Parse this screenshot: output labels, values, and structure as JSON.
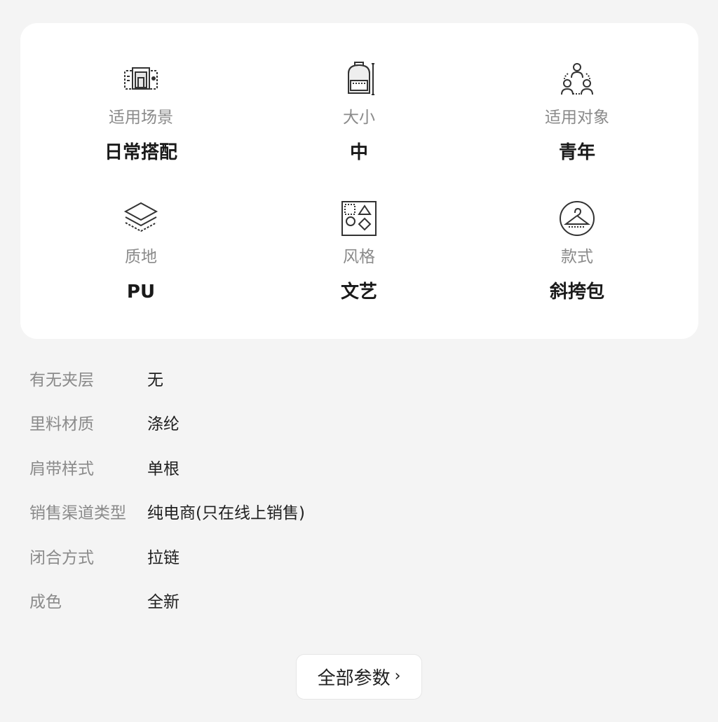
{
  "attributes": [
    {
      "label": "适用场景",
      "value": "日常搭配",
      "icon": "scene-photo-icon"
    },
    {
      "label": "大小",
      "value": "中",
      "icon": "backpack-size-icon"
    },
    {
      "label": "适用对象",
      "value": "青年",
      "icon": "people-group-icon"
    },
    {
      "label": "质地",
      "value": "PU",
      "icon": "layers-icon"
    },
    {
      "label": "风格",
      "value": "文艺",
      "icon": "shapes-style-icon"
    },
    {
      "label": "款式",
      "value": "斜挎包",
      "icon": "hanger-style-icon"
    }
  ],
  "specs": [
    {
      "key": "有无夹层",
      "value": "无"
    },
    {
      "key": "里料材质",
      "value": "涤纶"
    },
    {
      "key": "肩带样式",
      "value": "单根"
    },
    {
      "key": "销售渠道类型",
      "value": "纯电商(只在线上销售)"
    },
    {
      "key": "闭合方式",
      "value": "拉链"
    },
    {
      "key": "成色",
      "value": "全新"
    }
  ],
  "all_params_button": {
    "label": "全部参数",
    "chevron": "›"
  },
  "colors": {
    "background": "#f4f4f4",
    "card": "#ffffff",
    "label_gray": "#8a8a8a",
    "value_dark": "#1a1a1a"
  }
}
